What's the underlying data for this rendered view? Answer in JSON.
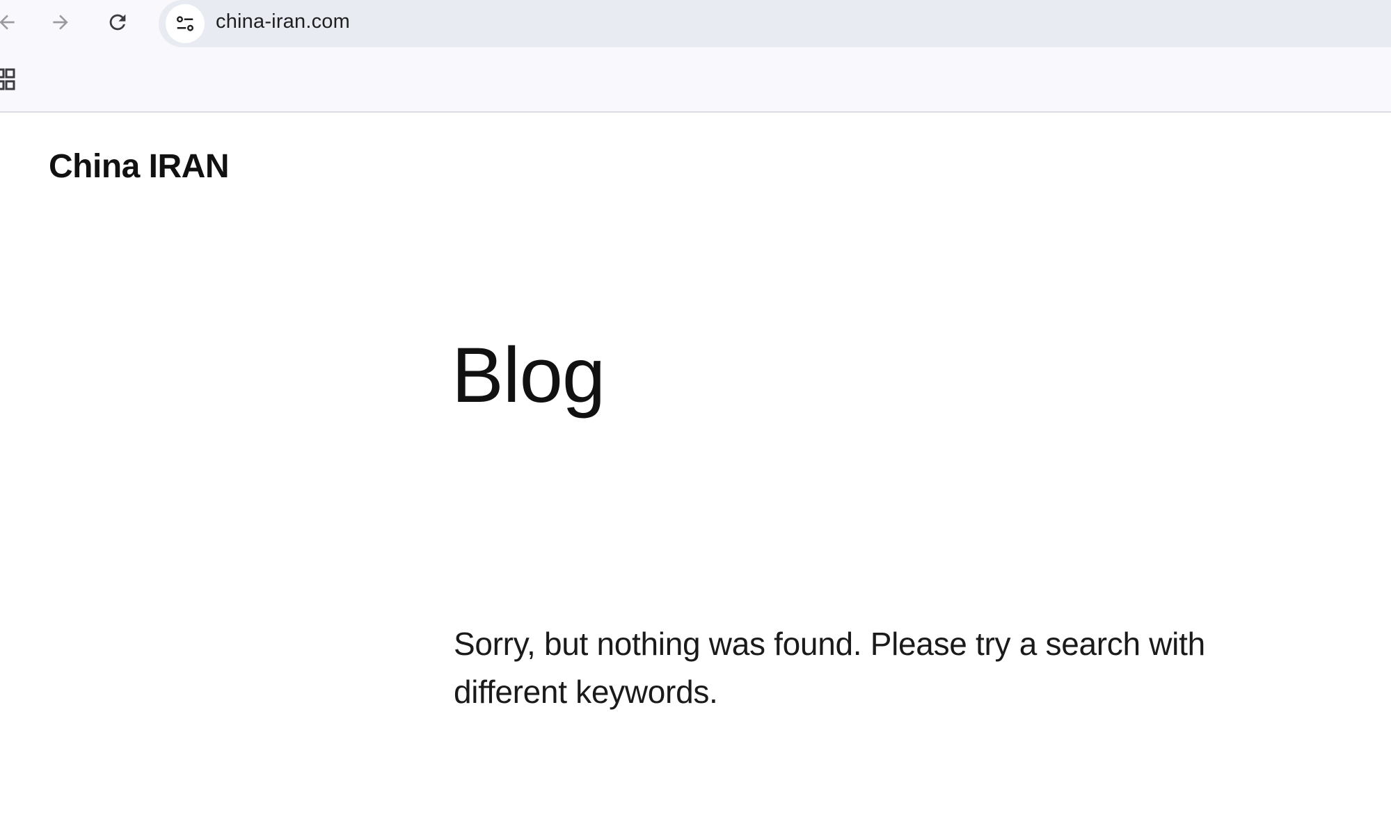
{
  "browser": {
    "back_icon": "arrow-left-icon",
    "forward_icon": "arrow-right-icon",
    "reload_icon": "reload-icon",
    "site_info_icon": "tune-icon",
    "url": "china-iran.com",
    "apps_icon": "apps-grid-icon"
  },
  "site": {
    "title": "China IRAN"
  },
  "main": {
    "heading": "Blog",
    "message": "Sorry, but nothing was found. Please try a search with different keywords."
  },
  "colors": {
    "chrome_bg": "#f8f8fd",
    "omnibox_bg": "#e9ebf3",
    "text": "#111111"
  }
}
